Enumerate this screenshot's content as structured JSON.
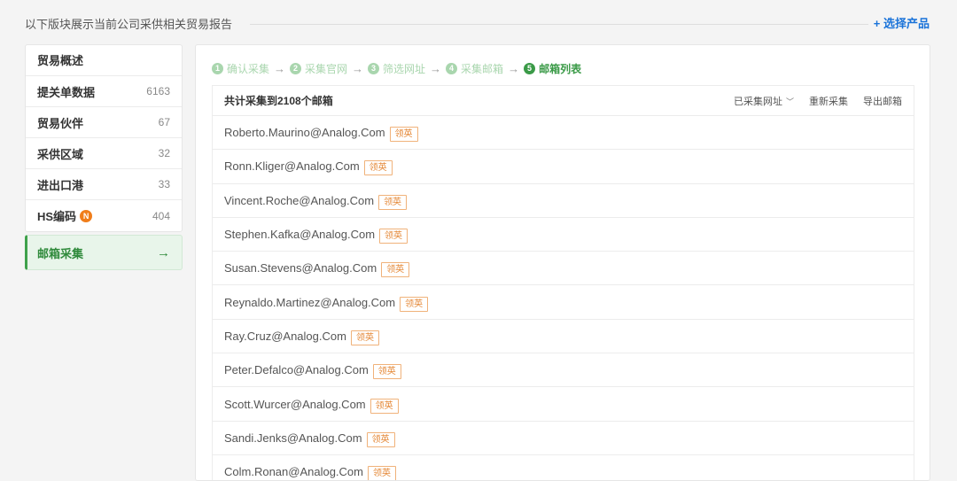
{
  "header": {
    "title": "以下版块展示当前公司采供相关贸易报告",
    "select_product": "+ 选择产品"
  },
  "sidebar": {
    "heading": "贸易概述",
    "items": [
      {
        "label": "提关单数据",
        "count": "6163"
      },
      {
        "label": "贸易伙伴",
        "count": "67"
      },
      {
        "label": "采供区域",
        "count": "32"
      },
      {
        "label": "进出口港",
        "count": "33"
      },
      {
        "label": "HS编码",
        "count": "404",
        "badge": "N"
      }
    ],
    "active_item": {
      "label": "邮箱采集",
      "arrow": "→"
    }
  },
  "steps": [
    {
      "num": "1",
      "label": "确认采集"
    },
    {
      "num": "2",
      "label": "采集官网"
    },
    {
      "num": "3",
      "label": "筛选网址"
    },
    {
      "num": "4",
      "label": "采集邮箱"
    },
    {
      "num": "5",
      "label": "邮箱列表"
    }
  ],
  "list": {
    "title": "共计采集到2108个邮箱",
    "actions": {
      "collected_sites": "已采集网址",
      "recollect": "重新采集",
      "export": "导出邮箱"
    },
    "tag_label": "领英",
    "emails": [
      "Roberto.Maurino@Analog.Com",
      "Ronn.Kliger@Analog.Com",
      "Vincent.Roche@Analog.Com",
      "Stephen.Kafka@Analog.Com",
      "Susan.Stevens@Analog.Com",
      "Reynaldo.Martinez@Analog.Com",
      "Ray.Cruz@Analog.Com",
      "Peter.Defalco@Analog.Com",
      "Scott.Wurcer@Analog.Com",
      "Sandi.Jenks@Analog.Com",
      "Colm.Ronan@Analog.Com"
    ]
  },
  "colors": {
    "accent_green": "#3a9a47",
    "link_blue": "#1a73d9",
    "tag_orange": "#e58a3a"
  }
}
